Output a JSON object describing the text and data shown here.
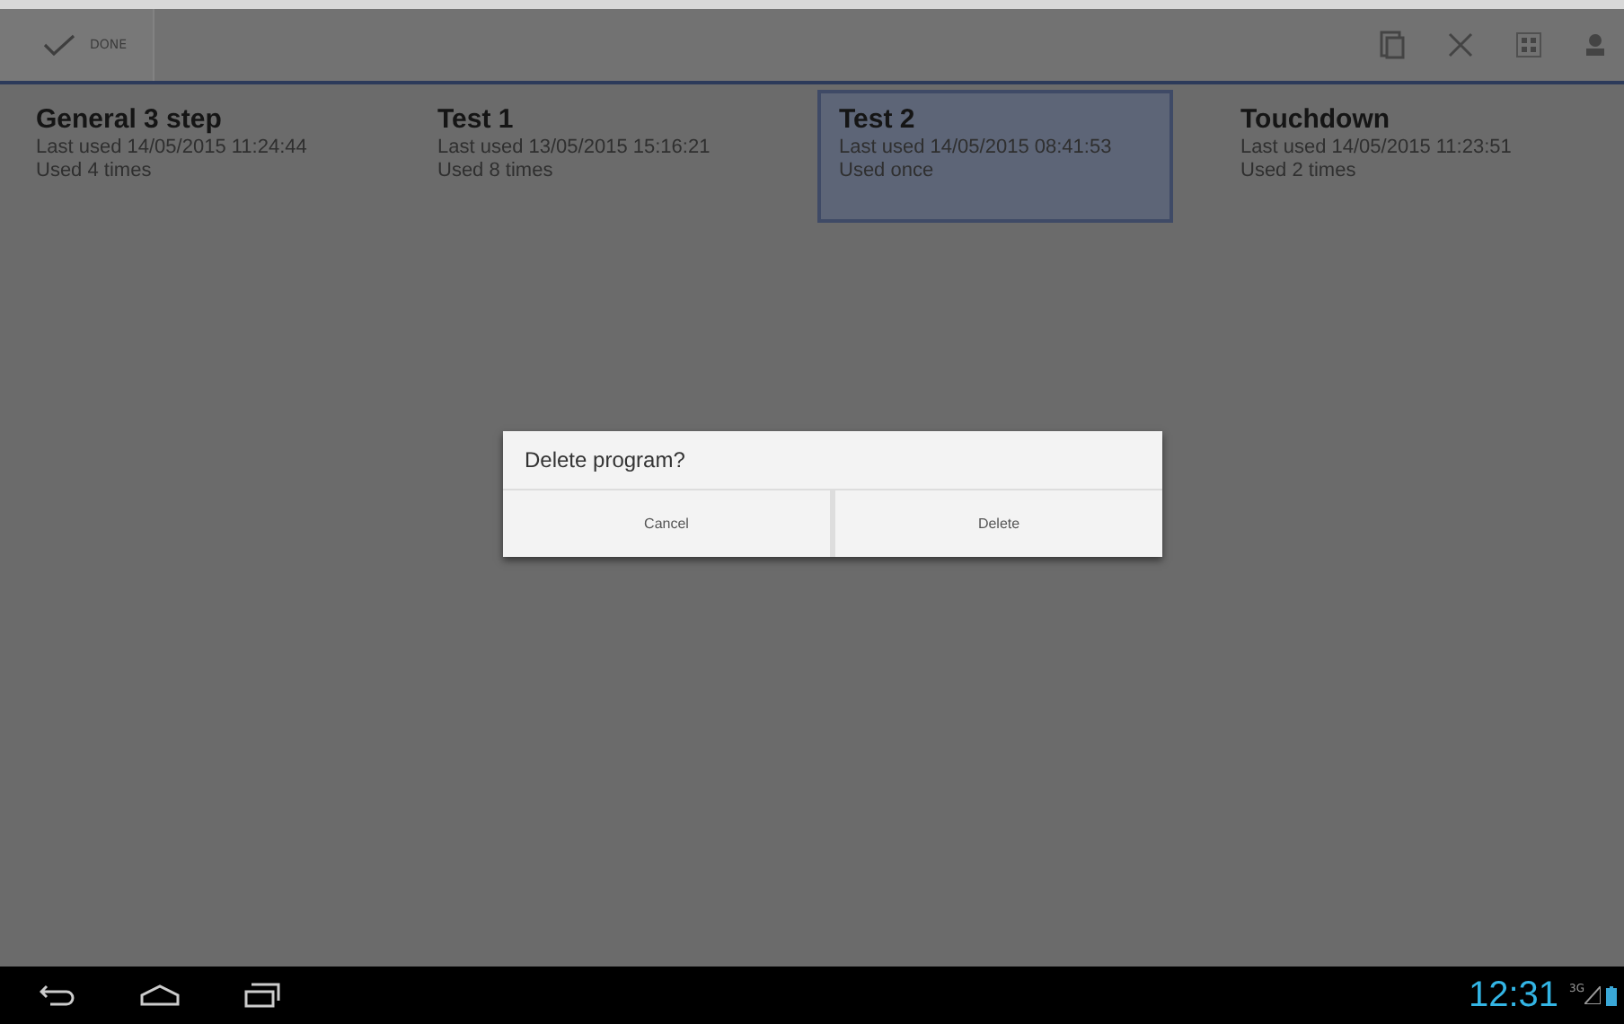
{
  "action_bar": {
    "done_label": "DONE"
  },
  "programs": [
    {
      "name": "General 3 step",
      "last_used": "Last used 14/05/2015 11:24:44",
      "usage": "Used 4 times",
      "selected": false
    },
    {
      "name": "Test 1",
      "last_used": "Last used 13/05/2015 15:16:21",
      "usage": "Used 8 times",
      "selected": false
    },
    {
      "name": "Test 2",
      "last_used": "Last used 14/05/2015 08:41:53",
      "usage": "Used once",
      "selected": true
    },
    {
      "name": "Touchdown",
      "last_used": "Last used 14/05/2015 11:23:51",
      "usage": "Used 2 times",
      "selected": false
    }
  ],
  "dialog": {
    "title": "Delete program?",
    "buttons": [
      "Cancel",
      "Delete"
    ]
  },
  "status_bar": {
    "time": "12:31",
    "network": "3G"
  }
}
